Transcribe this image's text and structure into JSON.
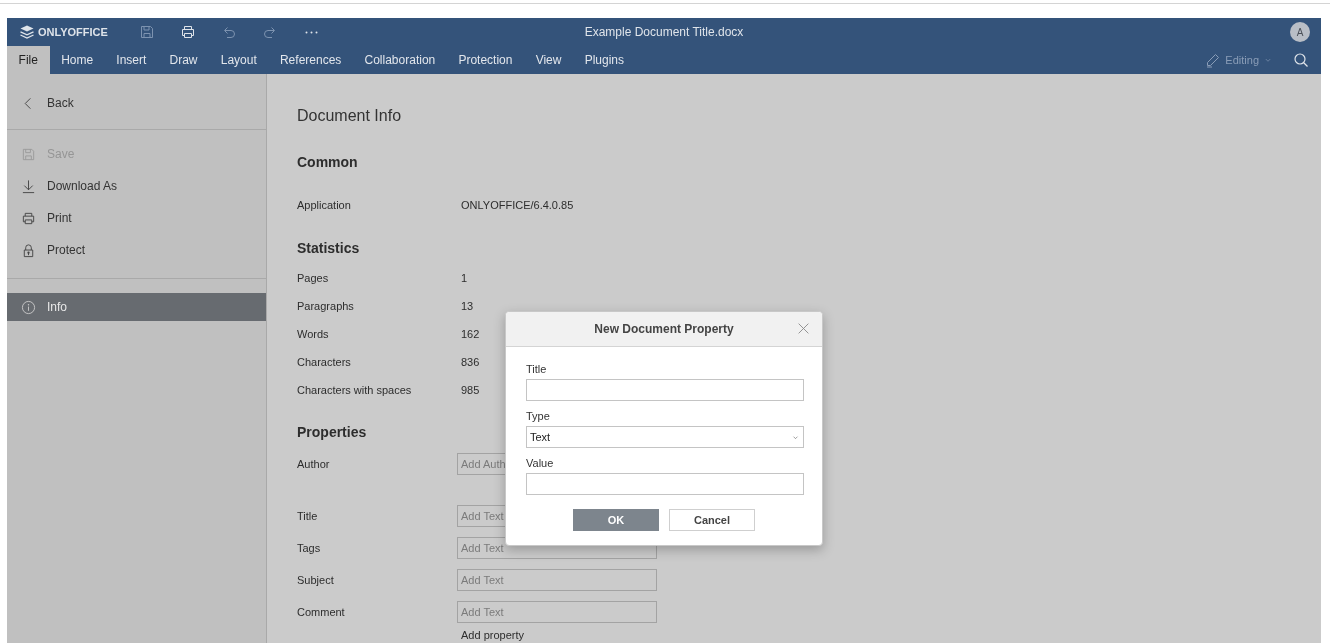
{
  "header": {
    "logo": "ONLYOFFICE",
    "title": "Example Document Title.docx",
    "avatar": "A",
    "toolbar": [
      {
        "kind": "save",
        "disabled": true
      },
      {
        "kind": "print",
        "disabled": false
      },
      {
        "kind": "undo",
        "disabled": true
      },
      {
        "kind": "redo",
        "disabled": true
      },
      {
        "kind": "more",
        "disabled": false
      }
    ],
    "tabs": [
      {
        "label": "File",
        "selected": true
      },
      {
        "label": "Home",
        "selected": false
      },
      {
        "label": "Insert",
        "selected": false
      },
      {
        "label": "Draw",
        "selected": false
      },
      {
        "label": "Layout",
        "selected": false
      },
      {
        "label": "References",
        "selected": false
      },
      {
        "label": "Collaboration",
        "selected": false
      },
      {
        "label": "Protection",
        "selected": false
      },
      {
        "label": "View",
        "selected": false
      },
      {
        "label": "Plugins",
        "selected": false
      }
    ],
    "mode": {
      "label": "Editing",
      "disabled": true
    }
  },
  "sidebar": {
    "groups": [
      [
        {
          "kind": "back",
          "label": "Back",
          "disabled": false,
          "selected": false
        }
      ],
      [
        {
          "kind": "save",
          "label": "Save",
          "disabled": true,
          "selected": false
        },
        {
          "kind": "download",
          "label": "Download As",
          "disabled": false,
          "selected": false
        },
        {
          "kind": "print",
          "label": "Print",
          "disabled": false,
          "selected": false
        },
        {
          "kind": "protect",
          "label": "Protect",
          "disabled": false,
          "selected": false
        }
      ],
      [
        {
          "kind": "info",
          "label": "Info",
          "disabled": false,
          "selected": true
        }
      ]
    ]
  },
  "content": {
    "heading": "Document Info",
    "common": {
      "title": "Common",
      "rows": [
        {
          "label": "Application",
          "value": "ONLYOFFICE/6.4.0.85"
        }
      ]
    },
    "statistics": {
      "title": "Statistics",
      "rows": [
        {
          "label": "Pages",
          "value": "1"
        },
        {
          "label": "Paragraphs",
          "value": "13"
        },
        {
          "label": "Words",
          "value": "162"
        },
        {
          "label": "Characters",
          "value": "836"
        },
        {
          "label": "Characters with spaces",
          "value": "985"
        }
      ]
    },
    "properties": {
      "title": "Properties",
      "fields": [
        {
          "label": "Author",
          "placeholder": "Add Auth"
        },
        {
          "label": "Title",
          "placeholder": "Add Text"
        },
        {
          "label": "Tags",
          "placeholder": "Add Text"
        },
        {
          "label": "Subject",
          "placeholder": "Add Text"
        },
        {
          "label": "Comment",
          "placeholder": "Add Text"
        }
      ],
      "add_property": "Add property"
    }
  },
  "dialog": {
    "title": "New Document Property",
    "fields": [
      {
        "kind": "text",
        "label": "Title"
      },
      {
        "kind": "select",
        "label": "Type",
        "value": "Text"
      },
      {
        "kind": "text",
        "label": "Value"
      }
    ],
    "buttons": [
      {
        "kind": "primary",
        "label": "OK"
      },
      {
        "kind": "secondary",
        "label": "Cancel"
      }
    ]
  }
}
